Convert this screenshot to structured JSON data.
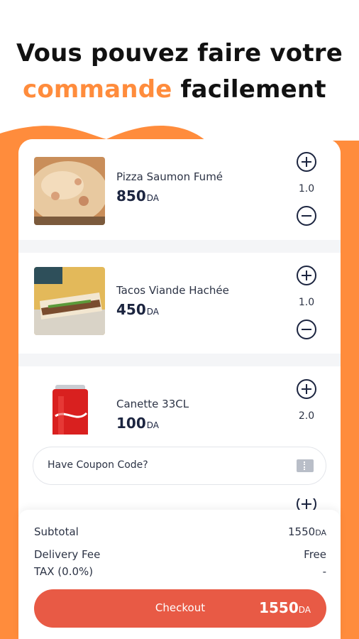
{
  "headline": {
    "line1": "Vous pouvez faire votre",
    "line2_accent": "commande",
    "line2_rest": " facilement"
  },
  "cart": {
    "currency": "DA",
    "items": [
      {
        "name": "Pizza Saumon Fumé",
        "price": "850",
        "qty": "1.0"
      },
      {
        "name": "Tacos Viande Hachée",
        "price": "450",
        "qty": "1.0"
      },
      {
        "name": "Canette 33CL",
        "price": "100",
        "qty": "2.0"
      }
    ]
  },
  "coupon": {
    "label": "Have Coupon Code?"
  },
  "summary": {
    "subtotal_label": "Subtotal",
    "subtotal_value": "1550",
    "delivery_label": "Delivery Fee",
    "delivery_value": "Free",
    "tax_label": "TAX (0.0%)",
    "tax_value": "-"
  },
  "checkout": {
    "label": "Checkout",
    "total": "1550"
  },
  "colors": {
    "accent": "#FF8C3C",
    "checkout": "#E85A45",
    "text": "#1c2540"
  }
}
